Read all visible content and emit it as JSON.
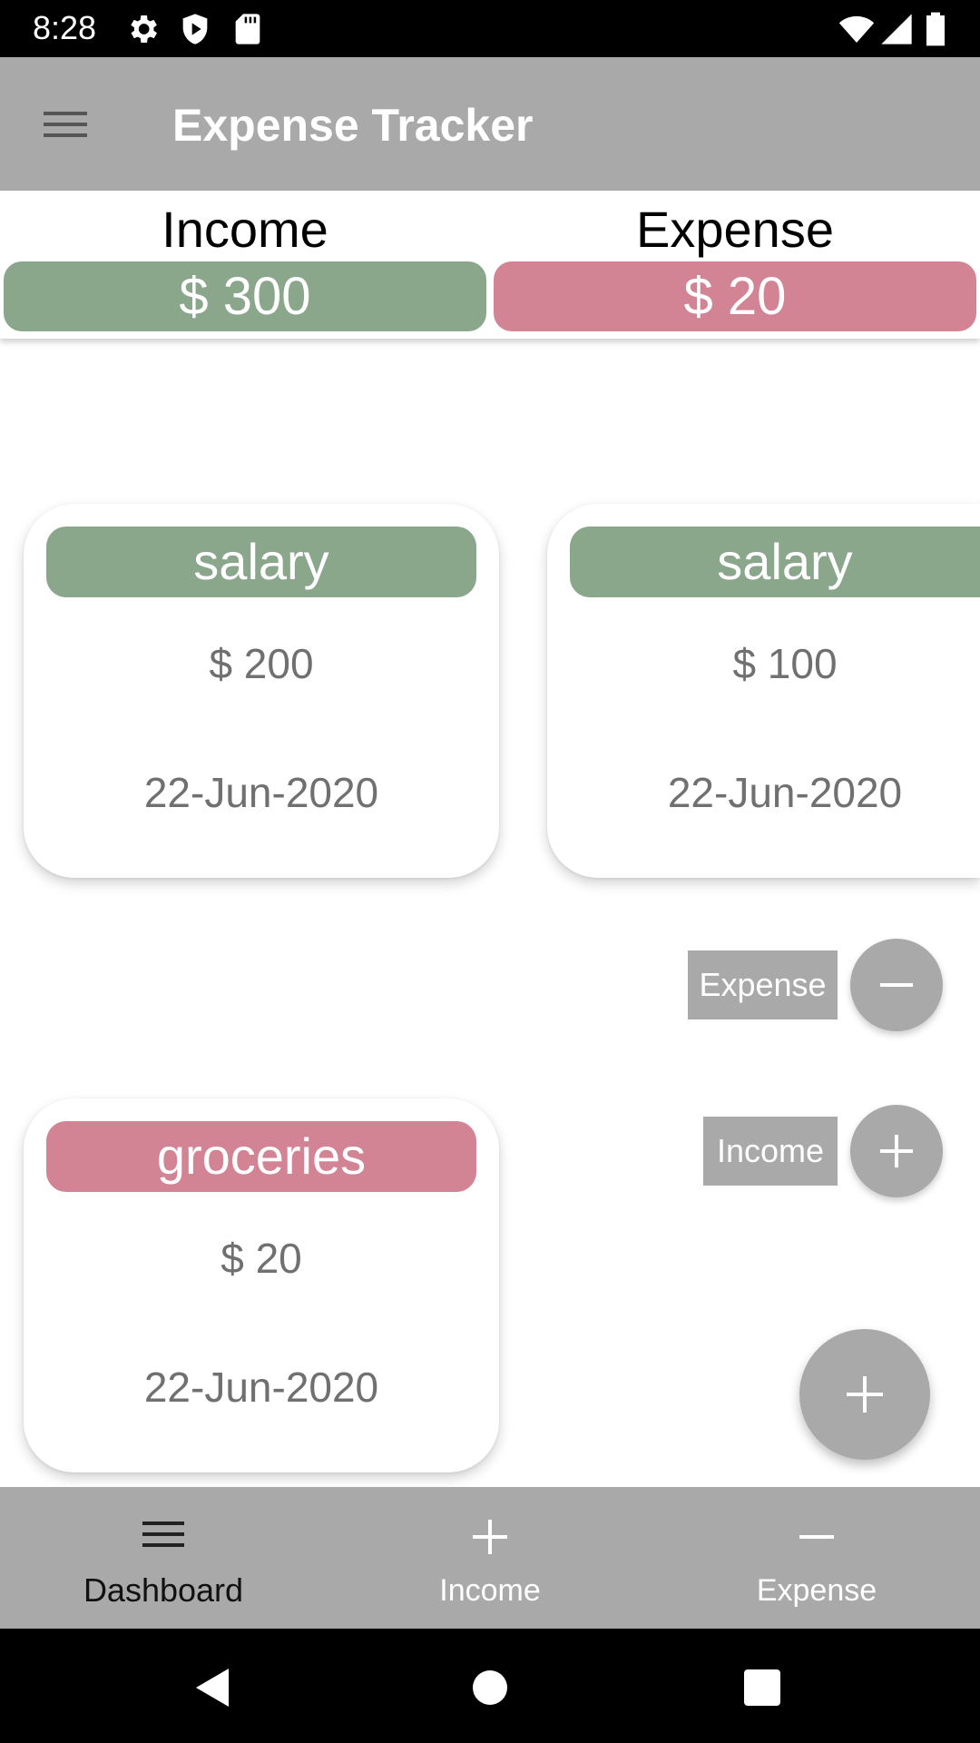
{
  "status_bar": {
    "time": "8:28",
    "icons": [
      "gear-icon",
      "shield-play-icon",
      "sd-card-icon",
      "wifi-icon",
      "signal-icon",
      "battery-icon"
    ]
  },
  "app_bar": {
    "title": "Expense Tracker",
    "menu_icon": "menu-icon"
  },
  "summary": {
    "income_label": "Income",
    "income_value": "$ 300",
    "expense_label": "Expense",
    "expense_value": "$ 20"
  },
  "cards": [
    {
      "category": "salary",
      "amount": "$ 200",
      "date": "22-Jun-2020",
      "type": "income"
    },
    {
      "category": "salary",
      "amount": "$ 100",
      "date": "22-Jun-2020",
      "type": "income"
    },
    {
      "category": "groceries",
      "amount": "$ 20",
      "date": "22-Jun-2020",
      "type": "expense"
    }
  ],
  "speed_dial": {
    "expense_label": "Expense",
    "income_label": "Income"
  },
  "bottom_nav": {
    "items": [
      {
        "label": "Dashboard",
        "icon": "menu-icon",
        "active": true
      },
      {
        "label": "Income",
        "icon": "plus-icon",
        "active": false
      },
      {
        "label": "Expense",
        "icon": "minus-icon",
        "active": false
      }
    ]
  },
  "colors": {
    "income": "#8aa68b",
    "expense": "#d28394",
    "appbar": "#a9a9a9",
    "muted_text": "#707070"
  }
}
